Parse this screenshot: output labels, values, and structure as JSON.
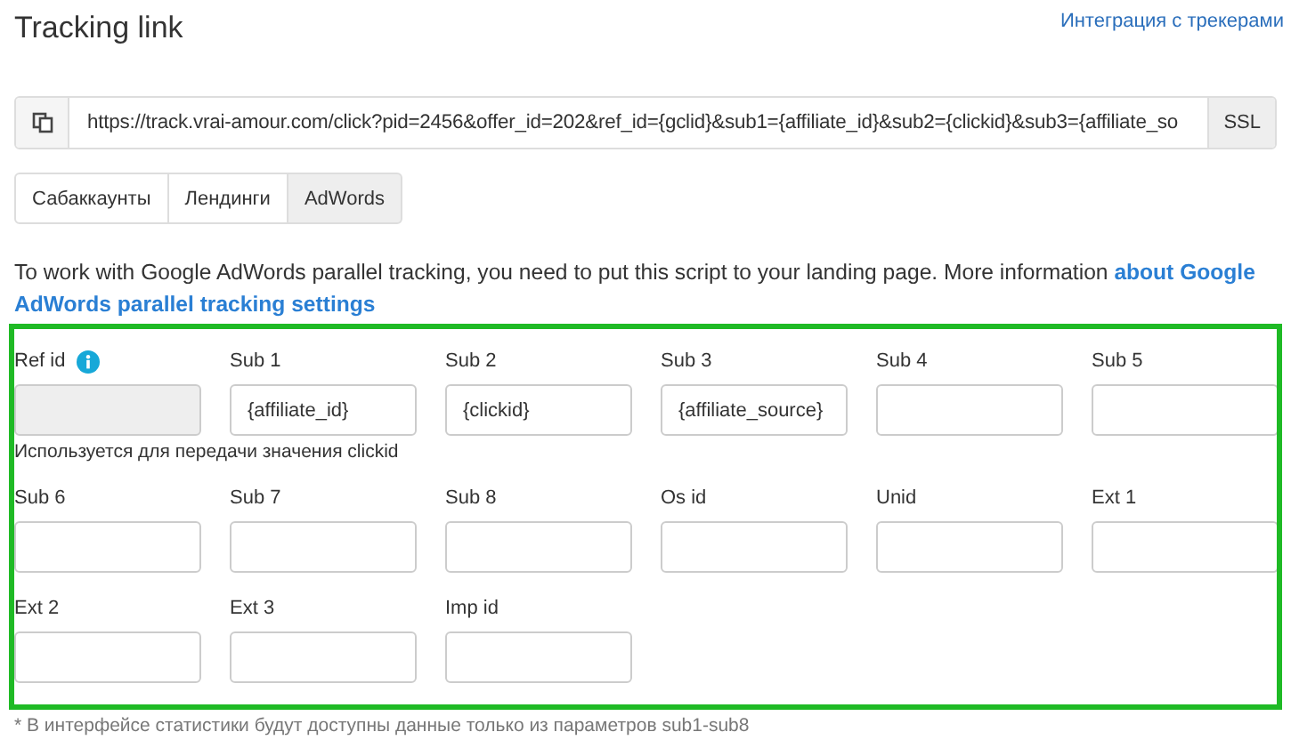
{
  "title": "Tracking link",
  "integration_link": "Интеграция с трекерами",
  "url_bar": {
    "url": "https://track.vrai-amour.com/click?pid=2456&offer_id=202&ref_id={gclid}&sub1={affiliate_id}&sub2={clickid}&sub3={affiliate_so",
    "ssl_label": "SSL"
  },
  "tabs": [
    {
      "label": "Сабаккаунты",
      "selected": false
    },
    {
      "label": "Лендинги",
      "selected": false
    },
    {
      "label": "AdWords",
      "selected": true
    }
  ],
  "intro": {
    "text": "To work with Google AdWords parallel tracking, you need to put this script to your landing page. More information",
    "link_lines": [
      "about Google",
      "AdWords parallel tracking settings"
    ]
  },
  "param_rows": [
    {
      "fields": [
        {
          "label": "Ref id",
          "info": true,
          "disabled": true
        },
        {
          "label": "Sub 1",
          "value": "{affiliate_id}"
        },
        {
          "label": "Sub 2",
          "value": "{clickid}"
        },
        {
          "label": "Sub 3",
          "value": "{affiliate_source}"
        },
        {
          "label": "Sub 4"
        },
        {
          "label": "Sub 5"
        }
      ],
      "help": "Используется для передачи значения clickid"
    },
    {
      "fields": [
        {
          "label": "Sub 6"
        },
        {
          "label": "Sub 7"
        },
        {
          "label": "Sub 8"
        },
        {
          "label": "Os id"
        },
        {
          "label": "Unid"
        },
        {
          "label": "Ext 1"
        }
      ]
    },
    {
      "fields": [
        {
          "label": "Ext 2"
        },
        {
          "label": "Ext 3"
        },
        {
          "label": "Imp id"
        }
      ]
    }
  ],
  "footnote": "* В интерфейсе статистики будут доступны данные только из параметров sub1-sub8"
}
